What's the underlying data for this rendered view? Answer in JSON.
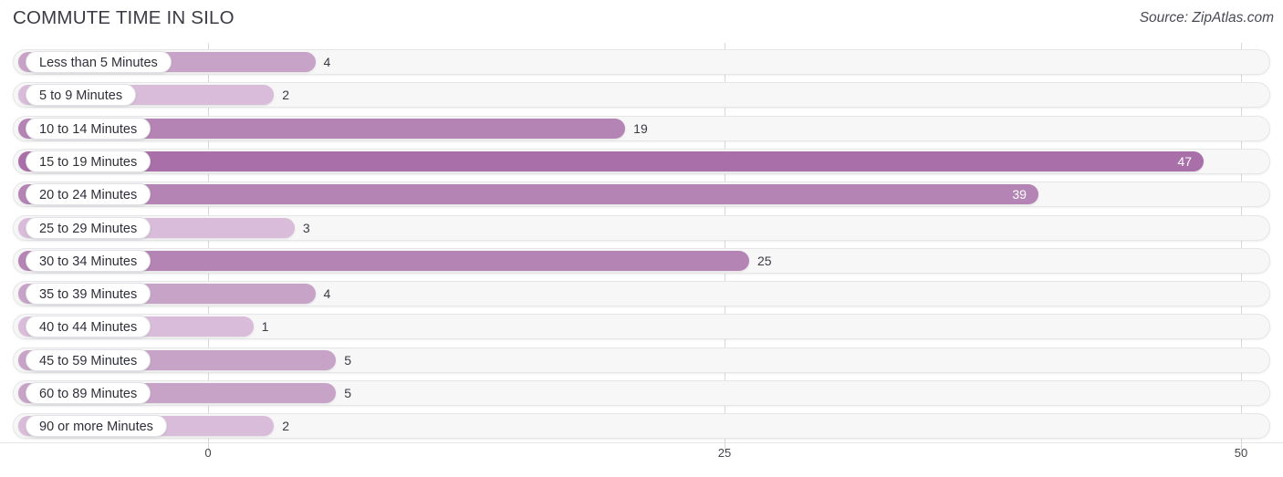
{
  "header": {
    "title": "COMMUTE TIME IN SILO",
    "source": "Source: ZipAtlas.com"
  },
  "colors": {
    "bar_light": "#d9bcd9",
    "bar_mid": "#c8a3c8",
    "bar_dark": "#b484b4",
    "bar_darkest": "#a86fa8",
    "track": "#f7f7f8",
    "gridline": "#d8d8dc",
    "text": "#33333a"
  },
  "chart_data": {
    "type": "bar",
    "orientation": "horizontal",
    "title": "COMMUTE TIME IN SILO",
    "xlabel": "",
    "ylabel": "",
    "xlim": [
      0,
      50
    ],
    "ticks": [
      0,
      25,
      50
    ],
    "tick_labels": [
      "0",
      "25",
      "50"
    ],
    "grid": true,
    "legend": false,
    "categories": [
      "Less than 5 Minutes",
      "5 to 9 Minutes",
      "10 to 14 Minutes",
      "15 to 19 Minutes",
      "20 to 24 Minutes",
      "25 to 29 Minutes",
      "30 to 34 Minutes",
      "35 to 39 Minutes",
      "40 to 44 Minutes",
      "45 to 59 Minutes",
      "60 to 89 Minutes",
      "90 or more Minutes"
    ],
    "values": [
      4,
      2,
      19,
      47,
      39,
      3,
      25,
      4,
      1,
      5,
      5,
      2
    ],
    "value_labels": [
      "4",
      "2",
      "19",
      "47",
      "39",
      "3",
      "25",
      "4",
      "1",
      "5",
      "5",
      "2"
    ]
  }
}
